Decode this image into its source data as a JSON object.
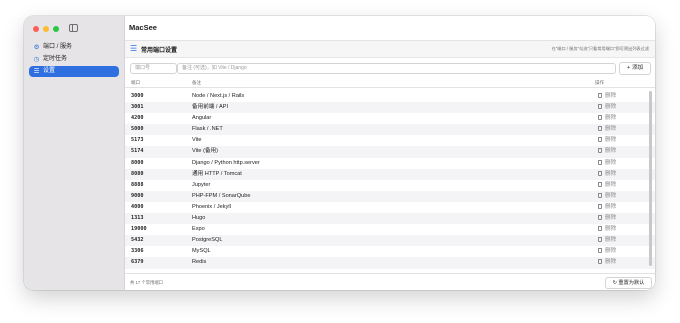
{
  "app": {
    "title": "MacSee"
  },
  "sidebar": {
    "items": [
      {
        "label": "端口 / 服务",
        "icon": "gear-icon",
        "active": false
      },
      {
        "label": "定时任务",
        "icon": "clock-icon",
        "active": false
      },
      {
        "label": "设置",
        "icon": "list-icon",
        "active": true
      }
    ]
  },
  "section": {
    "title": "常用端口设置",
    "icon": "list-icon",
    "hint": "在\"端口 / 服务\"勾选\"只看常用端口\"即可筛出列表过滤"
  },
  "form": {
    "port_placeholder": "端口号",
    "note_placeholder": "备注 (可选)，如 Vite / Django",
    "add_label": "添加"
  },
  "table": {
    "headers": {
      "port": "端口",
      "note": "备注",
      "actions": "操作"
    },
    "delete_label": "删除",
    "rows": [
      {
        "port": "3000",
        "note": "Node / Next.js / Rails"
      },
      {
        "port": "3001",
        "note": "备用前端 / API"
      },
      {
        "port": "4200",
        "note": "Angular"
      },
      {
        "port": "5000",
        "note": "Flask / .NET"
      },
      {
        "port": "5173",
        "note": "Vite"
      },
      {
        "port": "5174",
        "note": "Vite (备用)"
      },
      {
        "port": "8000",
        "note": "Django / Python http.server"
      },
      {
        "port": "8080",
        "note": "通用 HTTP / Tomcat"
      },
      {
        "port": "8888",
        "note": "Jupyter"
      },
      {
        "port": "9000",
        "note": "PHP-FPM / SonarQube"
      },
      {
        "port": "4000",
        "note": "Phoenix / Jekyll"
      },
      {
        "port": "1313",
        "note": "Hugo"
      },
      {
        "port": "19000",
        "note": "Expo"
      },
      {
        "port": "5432",
        "note": "PostgreSQL"
      },
      {
        "port": "3306",
        "note": "MySQL"
      },
      {
        "port": "6379",
        "note": "Redis"
      }
    ]
  },
  "footer": {
    "count_text": "共 17 个常用端口",
    "reset_label": "重置为默认"
  },
  "colors": {
    "accent": "#2f6fe0",
    "sidebar_bg": "#e6e4e7",
    "row_alt": "#f4f4f6"
  }
}
